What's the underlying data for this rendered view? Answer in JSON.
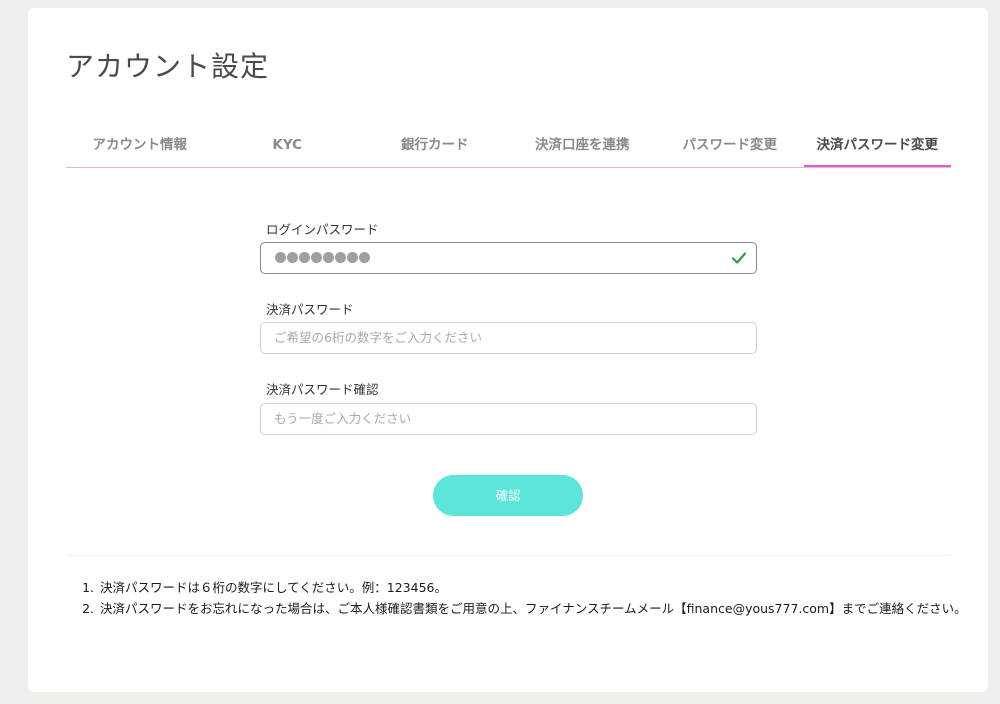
{
  "page": {
    "title": "アカウント設定"
  },
  "tabs": [
    {
      "label": "アカウント情報",
      "active": false
    },
    {
      "label": "KYC",
      "active": false
    },
    {
      "label": "銀行カード",
      "active": false
    },
    {
      "label": "決済口座を連携",
      "active": false
    },
    {
      "label": "パスワード変更",
      "active": false
    },
    {
      "label": "決済パスワード変更",
      "active": true
    }
  ],
  "form": {
    "login_password": {
      "label": "ログインパスワード",
      "masked_length": 8,
      "valid": true
    },
    "payment_password": {
      "label": "決済パスワード",
      "placeholder": "ご希望の6桁の数字をご入力ください"
    },
    "payment_password_confirm": {
      "label": "決済パスワード確認",
      "placeholder": "もう一度ご入力ください"
    },
    "submit_label": "確認"
  },
  "notes": [
    "決済パスワードは６桁の数字にしてください。例：123456。",
    "決済パスワードをお忘れになった場合は、ご本人様確認書類をご用意の上、ファイナンスチームメール【finance@yous777.com】までご連絡ください。"
  ],
  "colors": {
    "accent_pink": "#e05dc9",
    "button_teal": "#5ce6db",
    "check_green": "#2e9e3e"
  }
}
